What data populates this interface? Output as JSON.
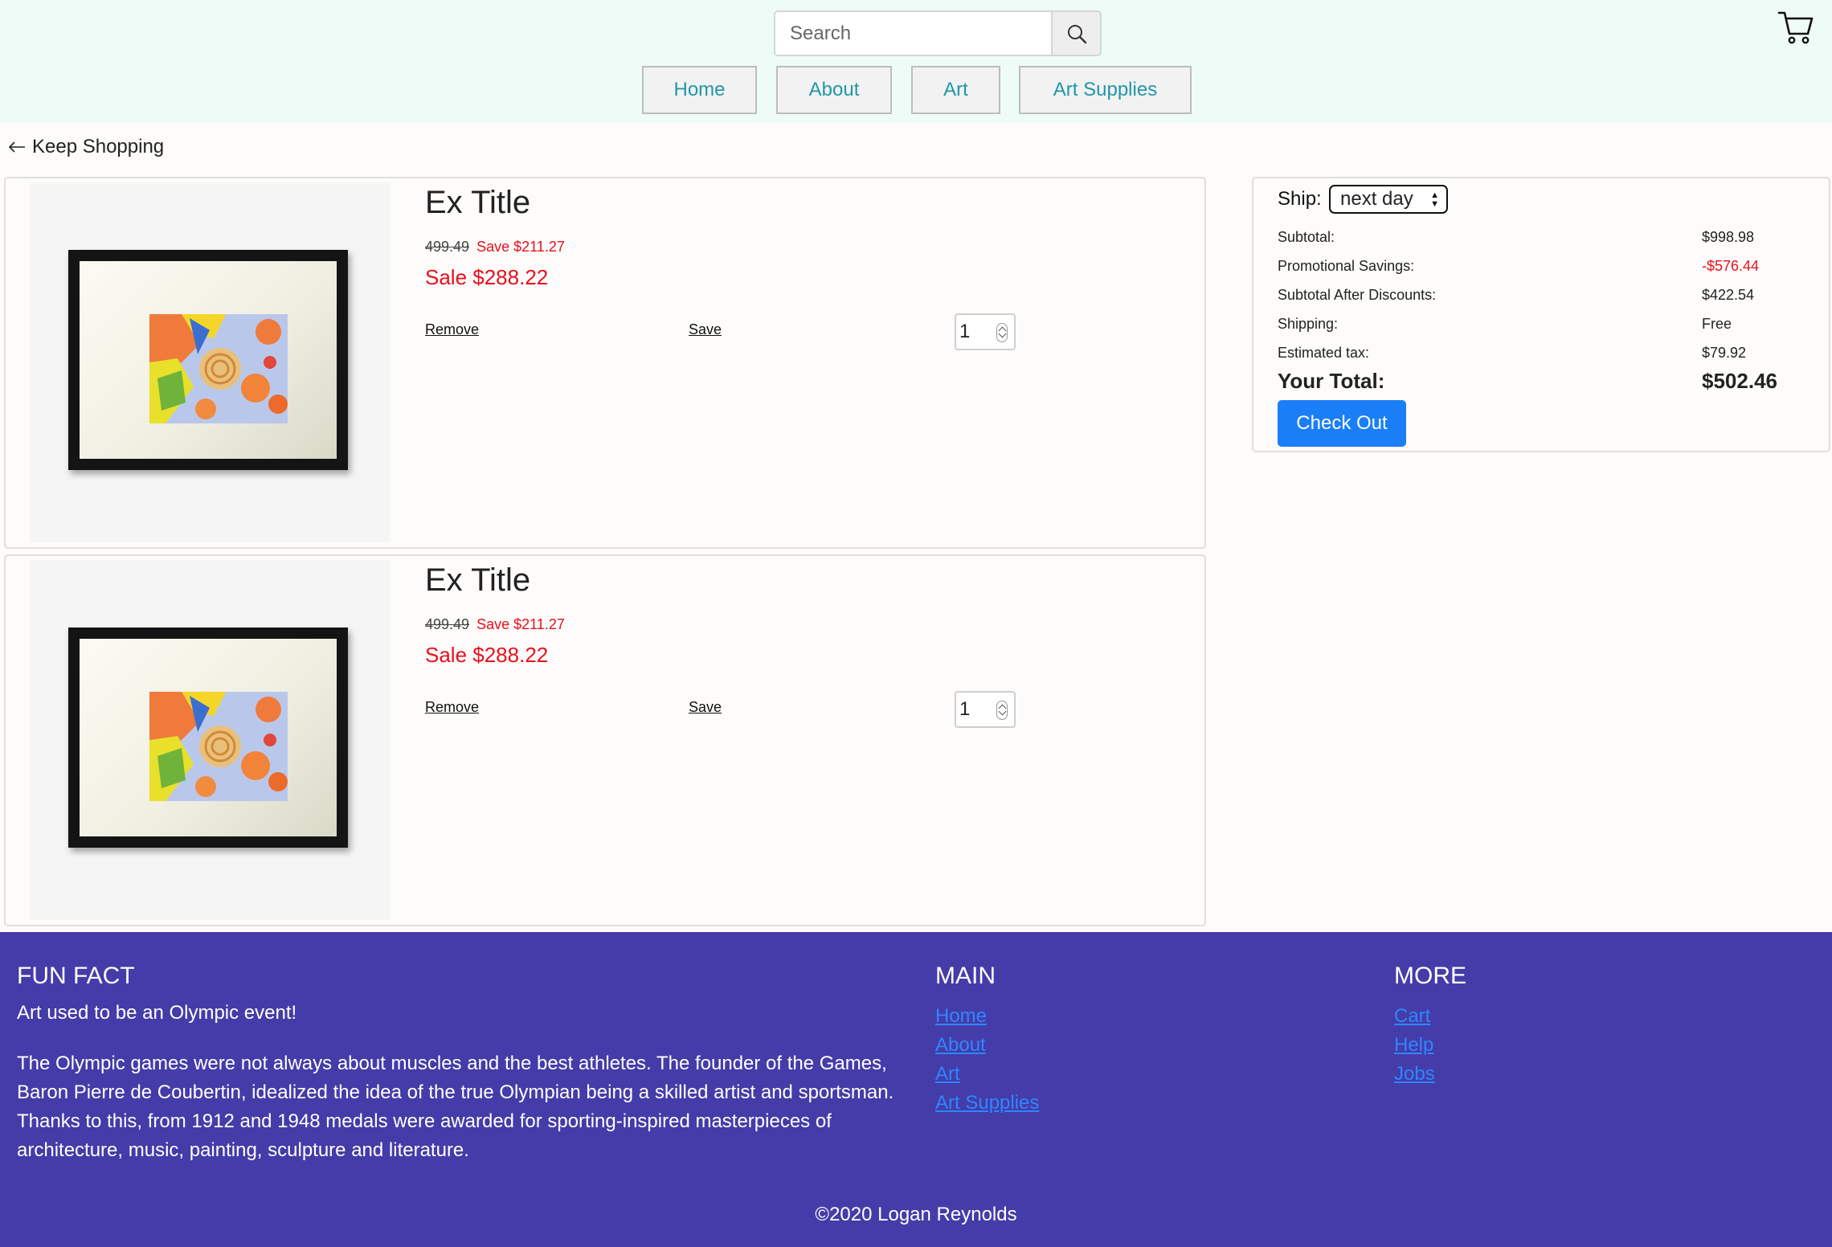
{
  "header": {
    "search_placeholder": "Search",
    "nav": [
      "Home",
      "About",
      "Art",
      "Art Supplies"
    ]
  },
  "keep_shopping": "Keep Shopping",
  "items": [
    {
      "title": "Ex Title",
      "original_price": "499.49",
      "save": "Save $211.27",
      "sale": "Sale $288.22",
      "remove": "Remove",
      "save_link": "Save",
      "qty": "1"
    },
    {
      "title": "Ex Title",
      "original_price": "499.49",
      "save": "Save $211.27",
      "sale": "Sale $288.22",
      "remove": "Remove",
      "save_link": "Save",
      "qty": "1"
    }
  ],
  "summary": {
    "ship_label": "Ship:",
    "ship_option": "next day",
    "rows": [
      {
        "label": "Subtotal:",
        "value": "$998.98"
      },
      {
        "label": "Promotional Savings:",
        "value": "-$576.44"
      },
      {
        "label": "Subtotal After Discounts:",
        "value": "$422.54"
      },
      {
        "label": "Shipping:",
        "value": "Free"
      },
      {
        "label": "Estimated tax:",
        "value": "$79.92"
      }
    ],
    "total_label": "Your Total:",
    "total_value": "$502.46",
    "checkout": "Check Out"
  },
  "footer": {
    "fun_fact_heading": "FUN FACT",
    "fun_fact_sub": "Art used to be an Olympic event!",
    "fun_fact_text": "The Olympic games were not always about muscles and the best athletes. The founder of the Games, Baron Pierre de Coubertin, idealized the idea of the true Olympian being a skilled artist and sportsman. Thanks to this, from 1912 and 1948 medals were awarded for sporting-inspired masterpieces of architecture, music, painting, sculpture and literature.",
    "main_heading": "MAIN",
    "main_links": [
      "Home",
      "About",
      "Art",
      "Art Supplies"
    ],
    "more_heading": "MORE",
    "more_links": [
      "Cart",
      "Help",
      "Jobs"
    ],
    "copyright": "©2020 Logan Reynolds"
  },
  "colors": {
    "header_bg": "#eefbf6",
    "nav_text": "#1f97a8",
    "sale_red": "#e8101e",
    "checkout_blue": "#1a7ef7",
    "footer_bg": "#443ca8",
    "footer_link": "#2f86ff"
  },
  "icons": [
    "search-icon",
    "cart-icon",
    "arrow-left-icon",
    "select-arrows-icon"
  ]
}
